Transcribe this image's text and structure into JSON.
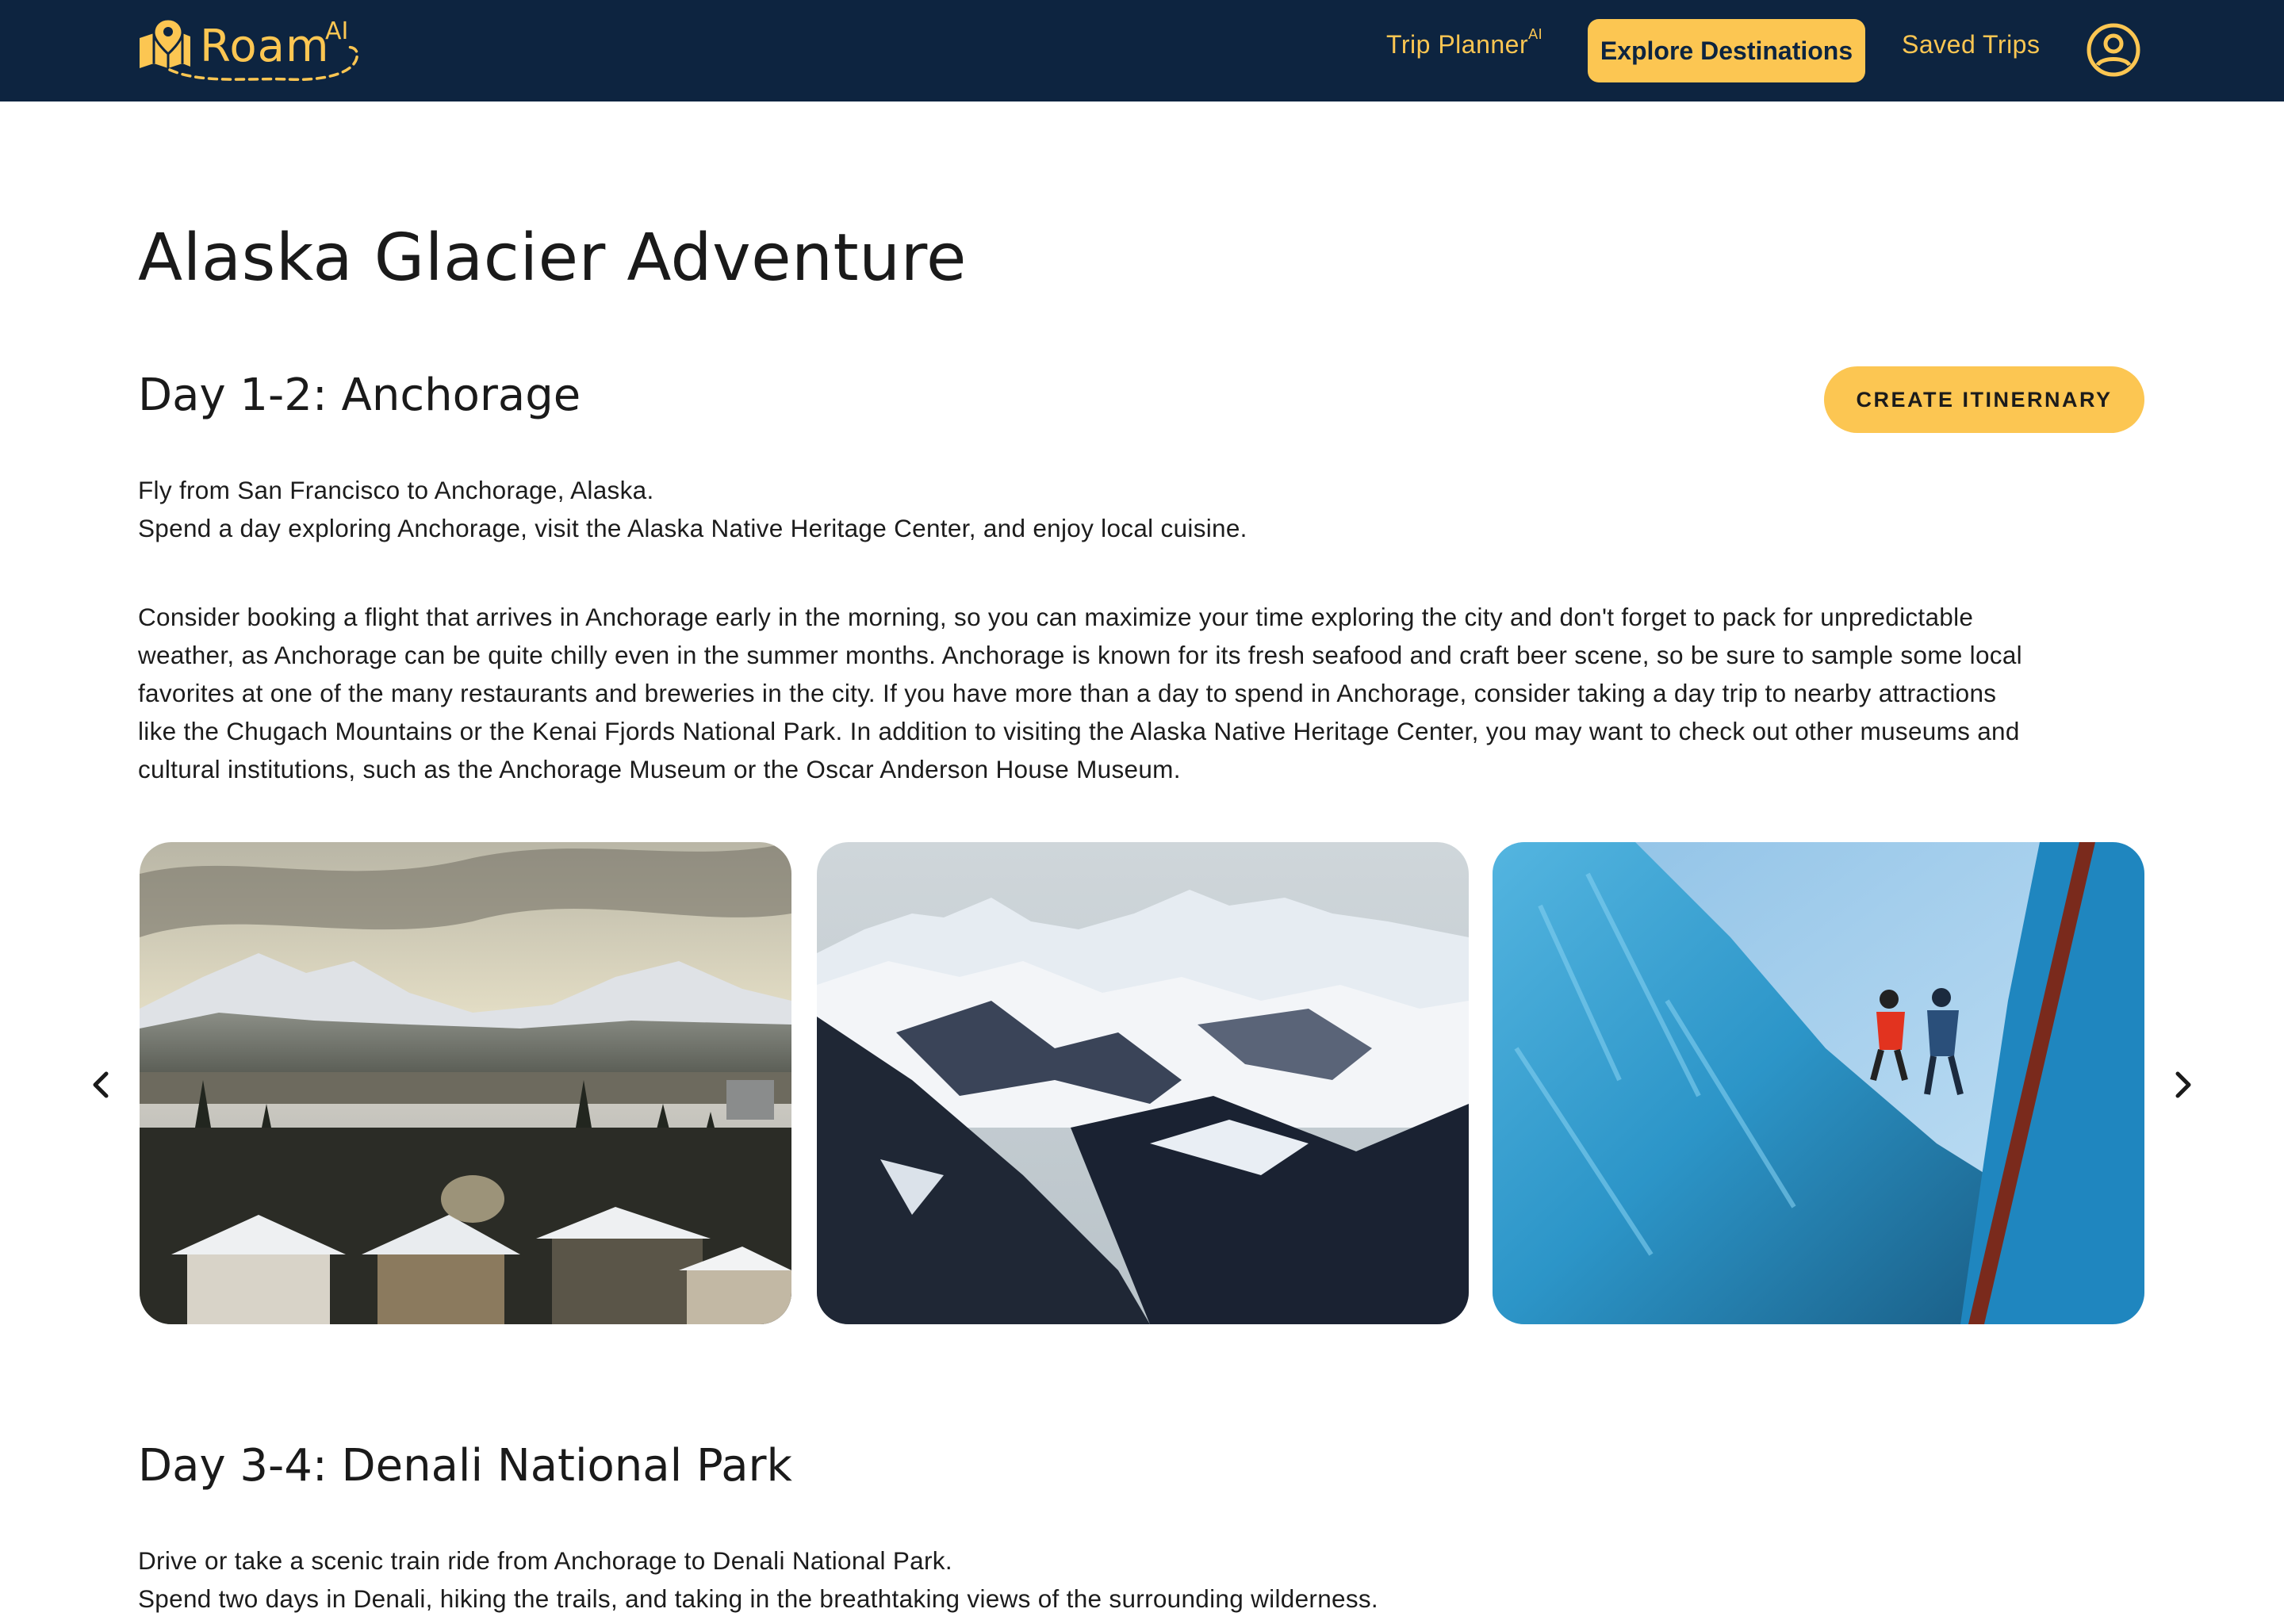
{
  "brand": {
    "name": "Roam",
    "suffix": "AI"
  },
  "nav": {
    "trip_planner": "Trip Planner",
    "trip_planner_sup": "AI",
    "explore": "Explore Destinations",
    "saved": "Saved Trips",
    "account_icon": "account-circle-icon"
  },
  "page": {
    "title": "Alaska Glacier Adventure"
  },
  "cta": {
    "label": "CREATE ITINERNARY"
  },
  "days": [
    {
      "title": "Day 1-2: Anchorage",
      "intro": [
        "Fly from San Francisco to Anchorage, Alaska.",
        "Spend a day exploring Anchorage, visit the Alaska Native Heritage Center, and enjoy local cuisine."
      ],
      "tip": [
        "Consider booking a flight that arrives in Anchorage early in the morning, so you can maximize your time exploring the city and don't forget to pack for unpredictable",
        "weather, as Anchorage can be quite chilly even in the summer months. Anchorage is known for its fresh seafood and craft beer scene, so be sure to sample some local",
        "favorites at one of the many restaurants and breweries in the city. If you have more than a day to spend in Anchorage, consider taking a day trip to nearby attractions",
        "like the Chugach Mountains or the Kenai Fjords National Park. In addition to visiting the Alaska Native Heritage Center, you may want to check out other museums and",
        "cultural institutions, such as the Anchorage Museum or the Oscar Anderson House Museum."
      ]
    },
    {
      "title": "Day 3-4: Denali National Park",
      "intro": [
        "Drive or take a scenic train ride from Anchorage to Denali National Park.",
        "Spend two days in Denali, hiking the trails, and taking in the breathtaking views of the surrounding wilderness."
      ]
    }
  ],
  "carousel": {
    "prev_icon": "chevron-left-icon",
    "next_icon": "chevron-right-icon"
  },
  "colors": {
    "navbar_bg": "#0d2440",
    "accent": "#fcc652",
    "text": "#1c1c1c"
  }
}
